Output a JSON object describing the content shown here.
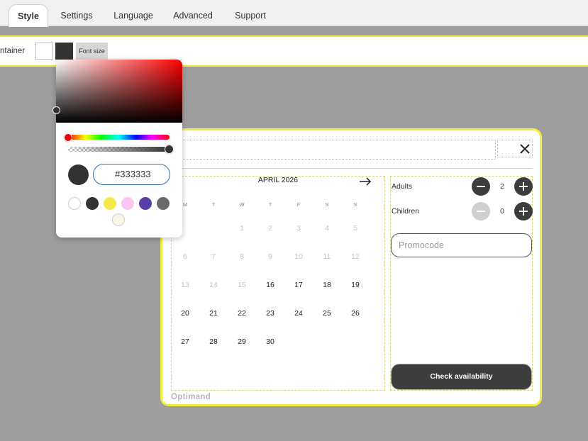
{
  "tabs": [
    {
      "label": "Style",
      "active": true
    },
    {
      "label": "Settings"
    },
    {
      "label": "Language"
    },
    {
      "label": "Advanced"
    },
    {
      "label": "Support"
    }
  ],
  "toolbar": {
    "container_label": "ntainer",
    "swatch_colors": [
      "#ffffff",
      "#333333"
    ],
    "font_size_label": "Font size"
  },
  "color_picker": {
    "hex_value": "#333333",
    "hue_color": "#ff0000",
    "alpha_percent": 100,
    "presets": [
      "#ffffff",
      "#333333",
      "#f7e84a",
      "#f7c6f1",
      "#5a3fa8",
      "#6a6a6a",
      "#f7f6e9"
    ]
  },
  "calendar": {
    "month_label": "APRIL 2026",
    "next_icon": "arrow-right-icon",
    "weekdays": [
      "M",
      "T",
      "W",
      "T",
      "F",
      "S",
      "S"
    ],
    "weeks": [
      [
        "",
        "",
        "1",
        "2",
        "3",
        "4",
        "5"
      ],
      [
        "6",
        "7",
        "8",
        "9",
        "10",
        "11",
        "12"
      ],
      [
        "13",
        "14",
        "15",
        "16",
        "17",
        "18",
        "19"
      ],
      [
        "20",
        "21",
        "22",
        "23",
        "24",
        "25",
        "26"
      ],
      [
        "27",
        "28",
        "29",
        "30",
        "",
        "",
        ""
      ]
    ],
    "disabled_days": [
      "1",
      "2",
      "3",
      "4",
      "5",
      "6",
      "7",
      "8",
      "9",
      "10",
      "11",
      "12",
      "13",
      "14",
      "15"
    ]
  },
  "guests": {
    "adults_label": "Adults",
    "adults_count": "2",
    "children_label": "Children",
    "children_count": "0"
  },
  "promo": {
    "placeholder": "Promocode"
  },
  "check_button": "Check availability",
  "brand": "Optimand",
  "close_icon": "close-icon"
}
